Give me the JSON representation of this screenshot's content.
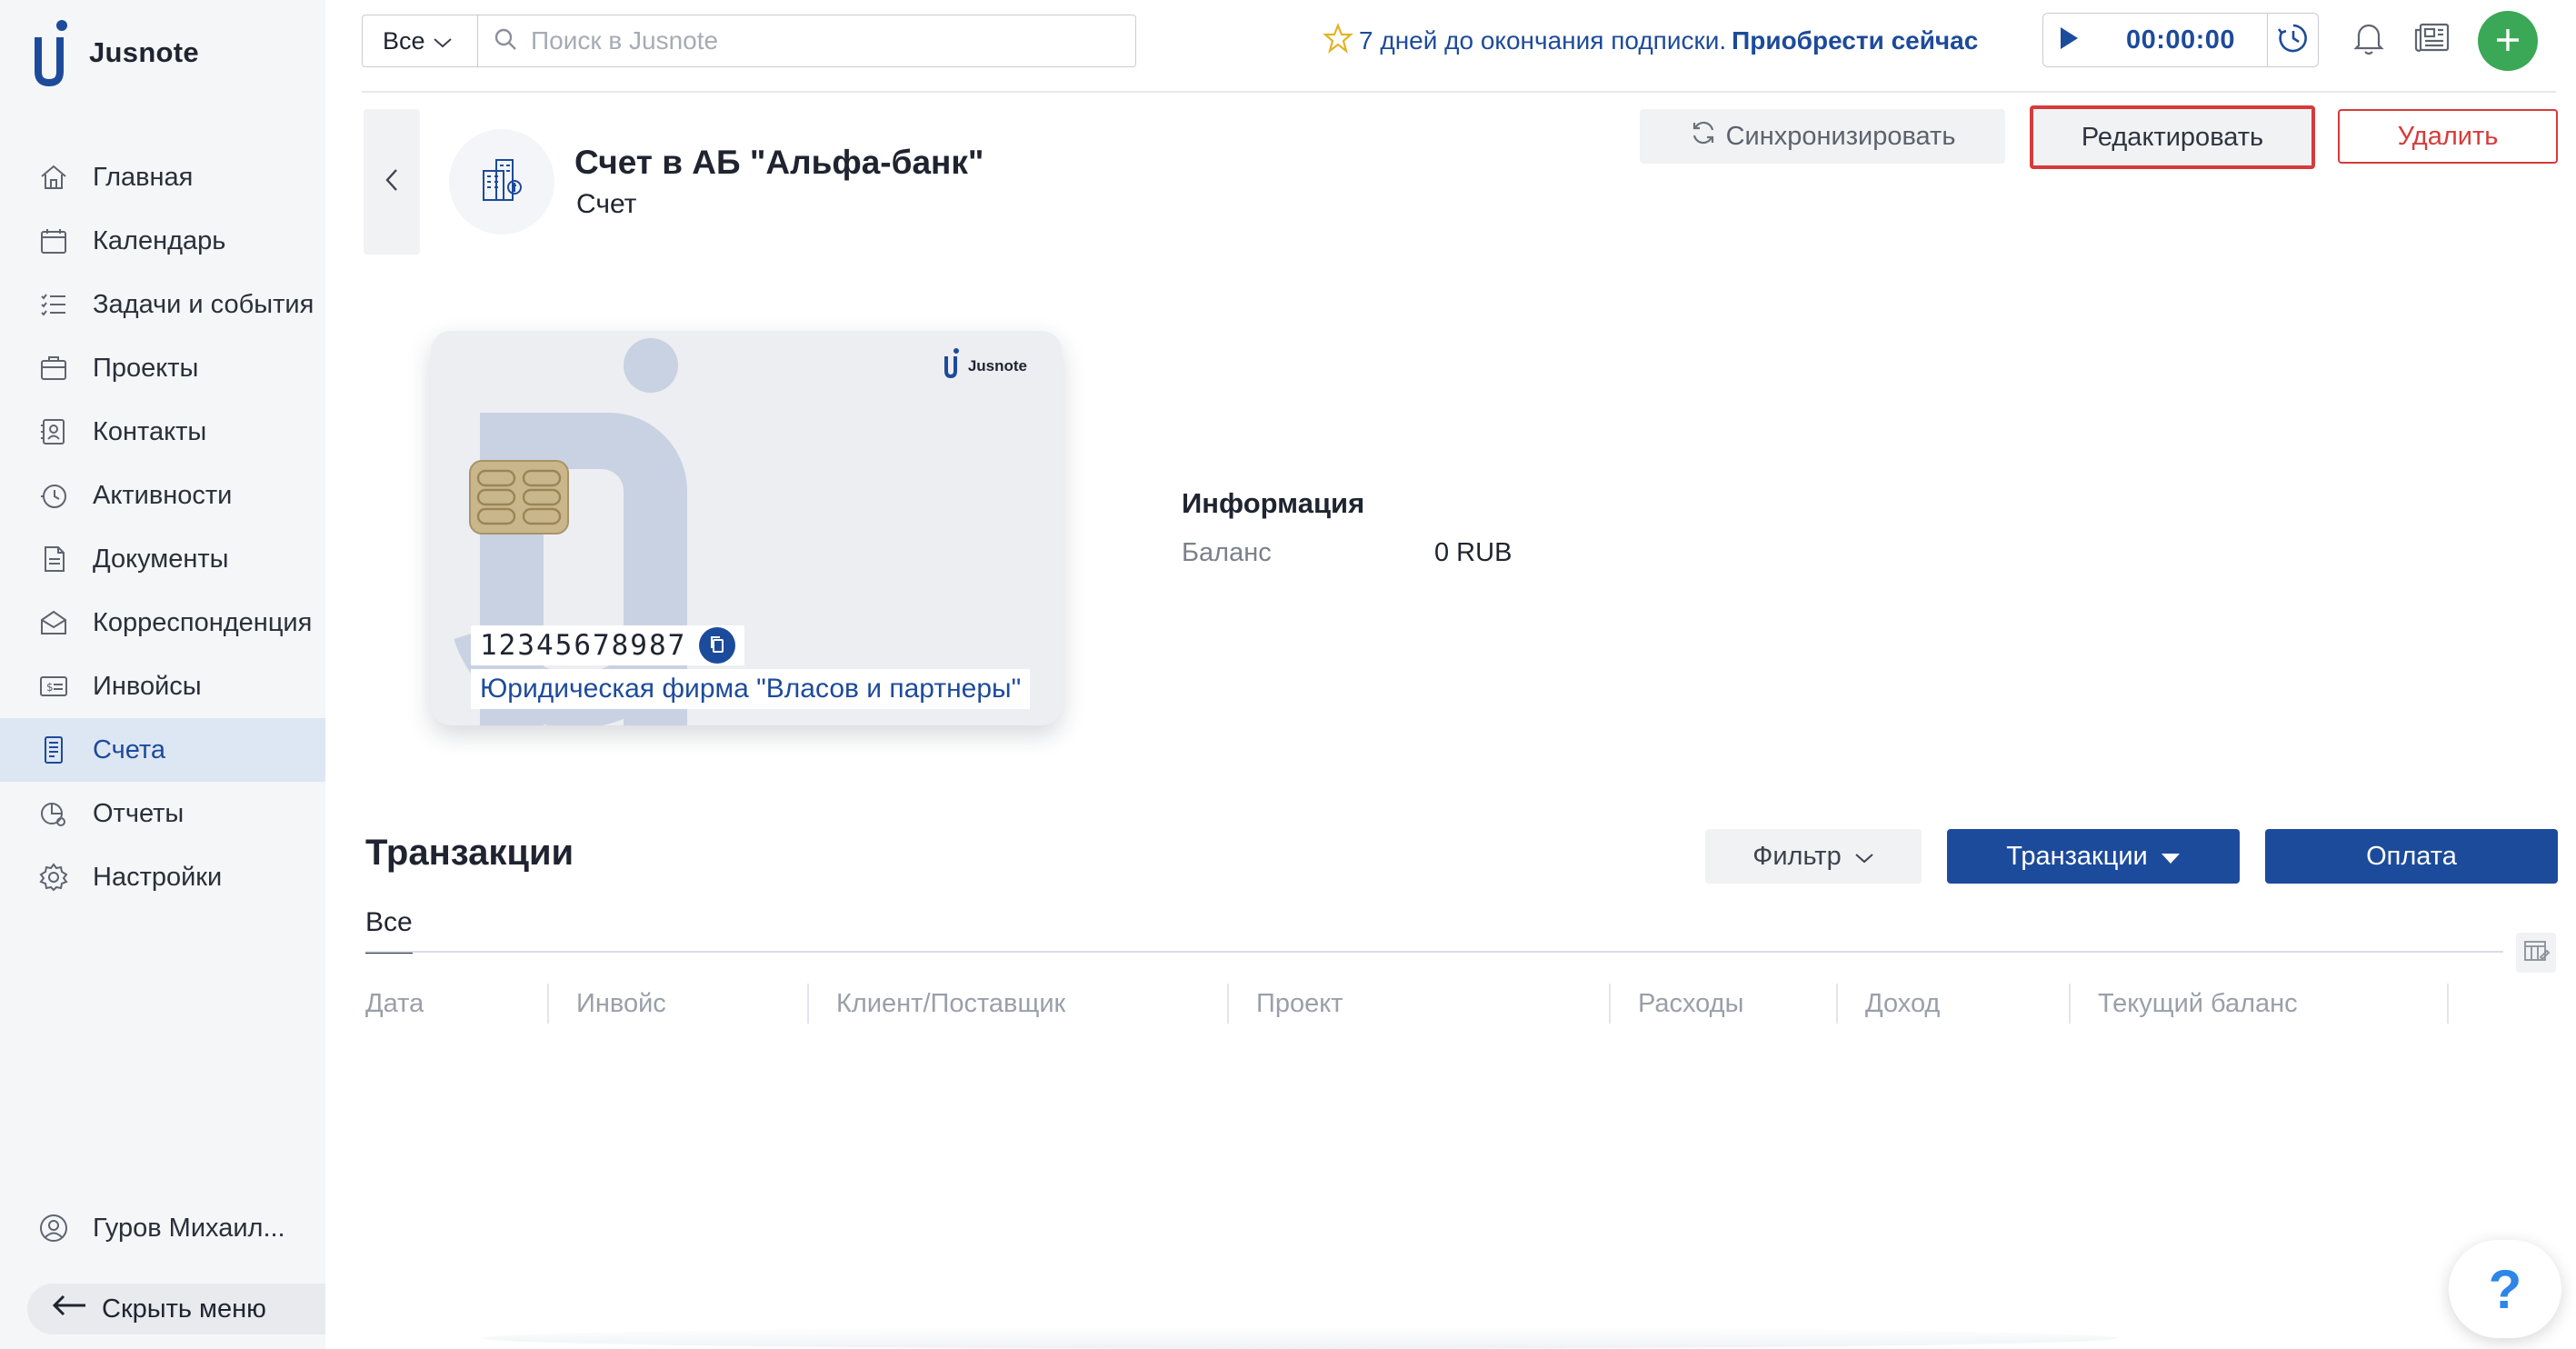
{
  "app": {
    "name": "Jusnote"
  },
  "sidebar": {
    "items": [
      {
        "label": "Главная",
        "icon": "home-icon",
        "active": false
      },
      {
        "label": "Календарь",
        "icon": "calendar-icon",
        "active": false
      },
      {
        "label": "Задачи и события",
        "icon": "tasks-icon",
        "active": false
      },
      {
        "label": "Проекты",
        "icon": "projects-icon",
        "active": false
      },
      {
        "label": "Контакты",
        "icon": "contacts-icon",
        "active": false
      },
      {
        "label": "Активности",
        "icon": "activity-icon",
        "active": false
      },
      {
        "label": "Документы",
        "icon": "documents-icon",
        "active": false
      },
      {
        "label": "Корреспонденция",
        "icon": "correspondence-icon",
        "active": false
      },
      {
        "label": "Инвойсы",
        "icon": "invoices-icon",
        "active": false
      },
      {
        "label": "Счета",
        "icon": "accounts-icon",
        "active": true
      },
      {
        "label": "Отчеты",
        "icon": "reports-icon",
        "active": false
      },
      {
        "label": "Настройки",
        "icon": "settings-icon",
        "active": false
      }
    ],
    "user_name": "Гуров Михаил...",
    "hide_menu_label": "Скрыть меню"
  },
  "topbar": {
    "scope_value": "Все",
    "search_placeholder": "Поиск в Jusnote",
    "subscription_text": "7 дней до окончания подписки.",
    "subscription_link": "Приобрести сейчас",
    "timer_value": "00:00:00"
  },
  "header": {
    "title": "Счет в АБ \"Альфа-банк\"",
    "subtitle": "Счет",
    "sync_label": "Синхронизировать",
    "edit_label": "Редактировать",
    "delete_label": "Удалить"
  },
  "card": {
    "brand": "Jusnote",
    "number": "12345678987",
    "owner": "Юридическая фирма \"Власов и партнеры\""
  },
  "info": {
    "title": "Информация",
    "balance_label": "Баланс",
    "balance_value": "0 RUB"
  },
  "transactions": {
    "title": "Транзакции",
    "filter_label": "Фильтр",
    "tx_button_label": "Транзакции",
    "pay_button_label": "Оплата",
    "tabs": [
      {
        "label": "Все",
        "active": true
      }
    ],
    "columns": [
      "Дата",
      "Инвойс",
      "Клиент/Поставщик",
      "Проект",
      "Расходы",
      "Доход",
      "Текущий баланс"
    ]
  },
  "help": {
    "label": "?"
  },
  "colors": {
    "brand_blue": "#1d4b9b",
    "danger": "#d63b3b",
    "success": "#3aa856",
    "sidebar_active_bg": "#dde6f3"
  }
}
